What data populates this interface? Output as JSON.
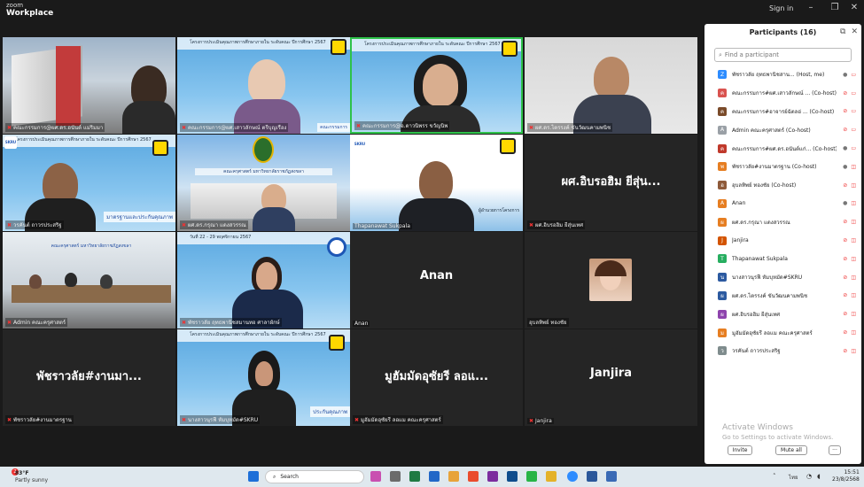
{
  "app": {
    "logo_line1": "zoom",
    "logo_line2": "Workplace",
    "signin": "Sign in"
  },
  "tiles": [
    {
      "name": "คณะกรรมการ@ผศ.ดร.อนันต์ แม่ริมมา"
    },
    {
      "name": "คณะกรรมการ@ผศ.เสาวลักษณ์ ตรีบุญเรือง"
    },
    {
      "name": "คณะกรรมการ@อ.ดาวนิพรร ขวัญนิพ"
    },
    {
      "name": "ผศ.ดร.ไตรรงค์ ขันวัฒนคามพนิช"
    },
    {
      "name": "วรคันต์ ถาวรประสริฐ"
    },
    {
      "name": "ผศ.ดร.กรุณา แดงสวรรณ"
    },
    {
      "name": "Thapanawat Sukpala"
    },
    {
      "name": "ผศ.อิบรอฮิม ยีสุ่นเทศ",
      "display": "ผศ.อิบรอฮิม ยีสุ่น..."
    },
    {
      "name": "Admin คณะครุศาสตร์"
    },
    {
      "name": "พัชราวลัย ฤทธพานิชสมานทอ ศาลาผักษ์"
    },
    {
      "name": "Anan",
      "display": "Anan"
    },
    {
      "name": "อุบลทิพย์ ทองชัย"
    },
    {
      "name": "พัชราวลัย#งานมาตรฐาน",
      "display": "พัชราวลัย#งานมา..."
    },
    {
      "name": "นางสาวนุรฟี หัมบุหมัด#SKRU"
    },
    {
      "name": "มูฮัมมัดอุซัยรี ลอแม คณะครุศาสตร์",
      "display": "มูฮัมมัดอุซัยรี ลอแ..."
    },
    {
      "name": "Janjira",
      "display": "Janjira"
    }
  ],
  "tile_texts": {
    "banner_a": "โครงการประเมินคุณภาพการศึกษาภายใน ระดับคณะ ปีการศึกษา 2567",
    "banner_b": "วันที่ 22 - 29 พฤศจิกายน 2567",
    "committee": "คณะกรรมการ",
    "quality": "มาตรฐานและประกันคุณภาพ",
    "faculty_sign": "คณะครุศาสตร์ มหาวิทยาลัยราชภัฏสงขลา",
    "role": "ผู้อำนวยการโครงการ",
    "skru": "SKRU",
    "office": "คณะครุศาสตร์ มหาวิทยาลัยราชภัฏสงขลา",
    "quality2": "ประกันคุณภาพ"
  },
  "panel": {
    "title": "Participants (16)",
    "search_placeholder": "Find a participant",
    "participants": [
      {
        "initial": "Z",
        "name": "พัชราวลัย ฤทธพานิชสาน... (Host, me)",
        "color": "#2d8cff",
        "mic": "on",
        "cam": "on"
      },
      {
        "initial": "ค",
        "name": "คณะกรรมการ#ผศ.เสาวลักษณ์ ... (Co-host)",
        "color": "#d9534f",
        "mic": "off",
        "cam": "on"
      },
      {
        "initial": "ค",
        "name": "คณะกรรมการ#อาจารย์ฉัตลอ่ ... (Co-host)",
        "color": "#7a4b2a",
        "mic": "off",
        "cam": "on"
      },
      {
        "initial": "A",
        "name": "Admin คณะครุศาสตร์ (Co-host)",
        "color": "#9aa0a6",
        "mic": "off",
        "cam": "on"
      },
      {
        "initial": "ค",
        "name": "คณะกรรมการ#ผศ.ดร.อนันต์แก่... (Co-host)",
        "color": "#c0392b",
        "mic": "on",
        "cam": "on"
      },
      {
        "initial": "พ",
        "name": "พัชราวลัย#งานมาตรฐาน (Co-host)",
        "color": "#e67e22",
        "mic": "on",
        "cam": "off"
      },
      {
        "initial": "อ",
        "name": "อุบลทิพย์ ทองชัย (Co-host)",
        "color": "#8e5a3a",
        "mic": "off",
        "cam": "off"
      },
      {
        "initial": "A",
        "name": "Anan",
        "color": "#e67e22",
        "mic": "on",
        "cam": "off"
      },
      {
        "initial": "ผ",
        "name": "ผศ.ดร.กรุณา แดงสวรรณ",
        "color": "#e67e22",
        "mic": "off",
        "cam": "off"
      },
      {
        "initial": "J",
        "name": "Janjira",
        "color": "#d35400",
        "mic": "off",
        "cam": "off"
      },
      {
        "initial": "T",
        "name": "Thapanawat Sukpala",
        "color": "#27ae60",
        "mic": "off",
        "cam": "off"
      },
      {
        "initial": "น",
        "name": "นางสาวนุรฟี หัมบุหมัด#SKRU",
        "color": "#2c5aa0",
        "mic": "off",
        "cam": "off"
      },
      {
        "initial": "ผ",
        "name": "ผศ.ดร.ไตรรงค์ ขันวัฒนคามพนิช",
        "color": "#2c5aa0",
        "mic": "off",
        "cam": "off"
      },
      {
        "initial": "ผ",
        "name": "ผศ.อิบรอฮิม ยีสุ่นเทศ",
        "color": "#8e44ad",
        "mic": "off",
        "cam": "off"
      },
      {
        "initial": "ม",
        "name": "มูฮัมมัดอุซัยรี ลอแม คณะครุศาสตร์",
        "color": "#e67e22",
        "mic": "off",
        "cam": "off"
      },
      {
        "initial": "ว",
        "name": "วรคันต์ ถาวรประสริฐ",
        "color": "#7f8c8d",
        "mic": "off",
        "cam": "off"
      }
    ],
    "watermark_title": "Activate Windows",
    "watermark_sub": "Go to Settings to activate Windows.",
    "invite": "Invite",
    "mute_all": "Mute all",
    "more": "···"
  },
  "taskbar": {
    "notif": "2",
    "temp": "83°F",
    "condition": "Partly sunny",
    "search": "Search",
    "lang": "ไทย",
    "time": "15:51",
    "date": "23/8/2568"
  }
}
